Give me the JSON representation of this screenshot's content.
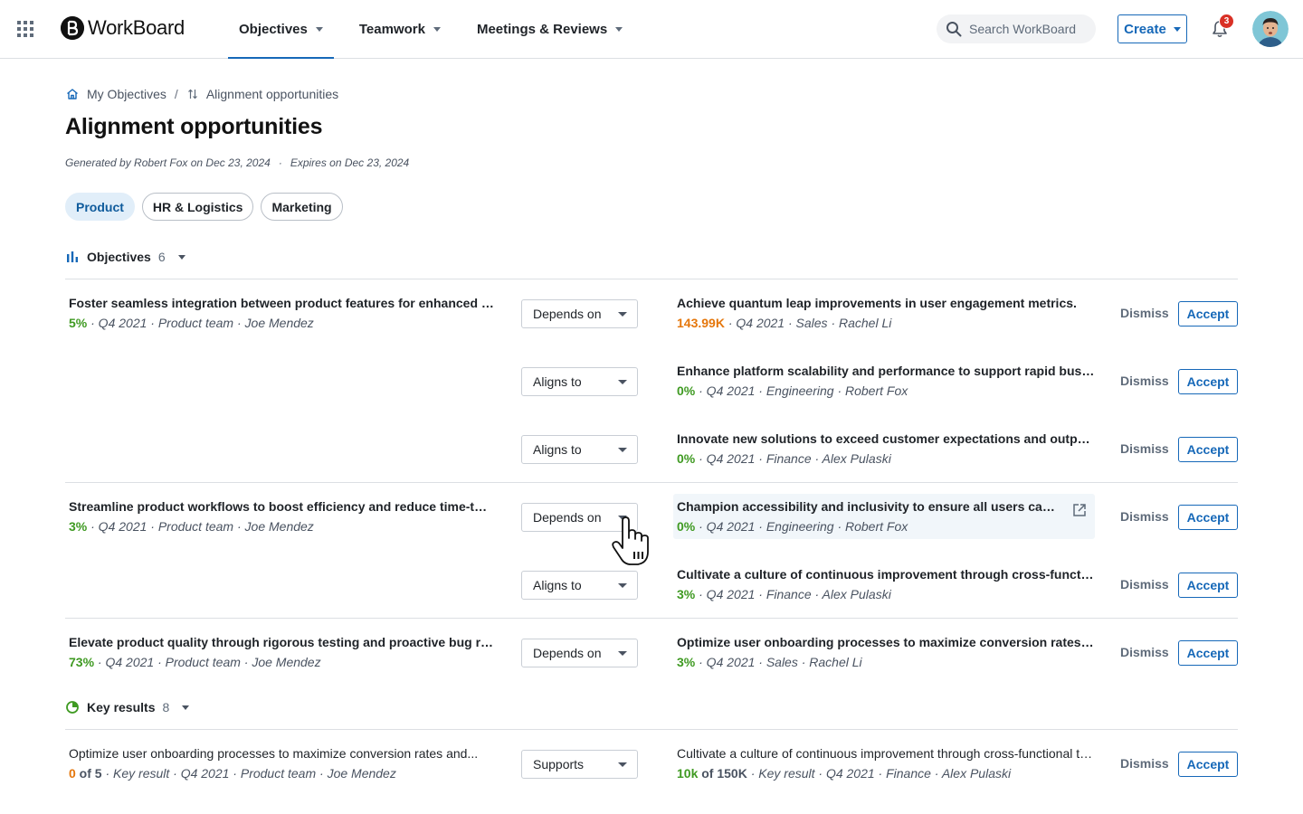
{
  "topbar": {
    "app_name": "WorkBoard",
    "nav": [
      {
        "label": "Objectives",
        "active": true
      },
      {
        "label": "Teamwork",
        "active": false
      },
      {
        "label": "Meetings & Reviews",
        "active": false
      }
    ],
    "search_placeholder": "Search WorkBoard",
    "create_label": "Create",
    "notification_count": "3"
  },
  "breadcrumb": {
    "home": "My Objectives",
    "separator": "/",
    "current": "Alignment opportunities"
  },
  "page": {
    "title": "Alignment opportunities",
    "generated": "Generated by Robert Fox on Dec 23, 2024",
    "meta_dot": "·",
    "expires": "Expires on Dec 23, 2024"
  },
  "filters": [
    {
      "label": "Product",
      "selected": true
    },
    {
      "label": "HR & Logistics",
      "selected": false
    },
    {
      "label": "Marketing",
      "selected": false
    }
  ],
  "actions": {
    "dismiss": "Dismiss",
    "accept": "Accept"
  },
  "objectives": {
    "label": "Objectives",
    "count": "6",
    "rows": [
      {
        "source": {
          "title": "Foster seamless integration between product features for enhanced us...",
          "progress": "5%",
          "progress_color": "#3f9a22",
          "meta": " · Q4 2021 · Product team · Joe Mendez"
        },
        "relation": "Depends on",
        "target": {
          "title": "Achieve quantum leap improvements in user engagement metrics.",
          "progress": "143.99K",
          "progress_color": "#e5770c",
          "meta": " · Q4 2021 · Sales · Rachel Li"
        }
      },
      {
        "relation": "Aligns to",
        "target": {
          "title": "Enhance platform scalability and performance to support rapid business growth",
          "progress": "0%",
          "progress_color": "#3f9a22",
          "meta": " · Q4 2021 · Engineering · Robert Fox"
        }
      },
      {
        "relation": "Aligns to",
        "target": {
          "title": "Innovate new solutions to exceed customer expectations and outpace competitors",
          "progress": "0%",
          "progress_color": "#3f9a22",
          "meta": " · Q4 2021 · Finance · Alex Pulaski"
        }
      },
      {
        "source": {
          "title": "Streamline product workflows to boost efficiency and reduce time-to-market",
          "progress": "3%",
          "progress_color": "#3f9a22",
          "meta": " · Q4 2021 · Product team · Joe Mendez"
        },
        "relation": "Depends on",
        "target": {
          "title": "Champion accessibility and inclusivity to ensure all users can fully engage",
          "progress": "0%",
          "progress_color": "#3f9a22",
          "meta": " · Q4 2021 · Engineering · Robert Fox"
        }
      },
      {
        "relation": "Aligns to",
        "target": {
          "title": "Cultivate a culture of continuous improvement through cross-functional teams",
          "progress": "3%",
          "progress_color": "#3f9a22",
          "meta": " · Q4 2021 · Finance · Alex Pulaski"
        }
      },
      {
        "source": {
          "title": "Elevate product quality through rigorous testing and proactive bug resolution",
          "progress": "73%",
          "progress_color": "#3f9a22",
          "meta": " · Q4 2021 · Product team · Joe Mendez"
        },
        "relation": "Depends on",
        "target": {
          "title": "Optimize user onboarding processes to maximize conversion rates and retention",
          "progress": "3%",
          "progress_color": "#3f9a22",
          "meta": " · Q4 2021 · Sales · Rachel Li"
        }
      }
    ]
  },
  "key_results": {
    "label": "Key results",
    "count": "8",
    "rows": [
      {
        "source": {
          "title": "Optimize user onboarding processes to maximize conversion rates and...",
          "progress_current": "0",
          "progress_color": "#e5770c",
          "progress_total": " of 5",
          "meta": " · Key result · Q4 2021 · Product team · Joe Mendez"
        },
        "relation": "Supports",
        "target": {
          "title": "Cultivate a culture of continuous improvement through cross-functional teams",
          "progress_current": "10k",
          "progress_color": "#3f9a22",
          "progress_total": " of 150K",
          "meta": " · Key result · Q4 2021 · Finance · Alex Pulaski"
        }
      }
    ]
  },
  "colors": {
    "accent": "#1668b8",
    "success": "#3f9a22",
    "warning": "#e5770c",
    "badge": "#d93025"
  }
}
